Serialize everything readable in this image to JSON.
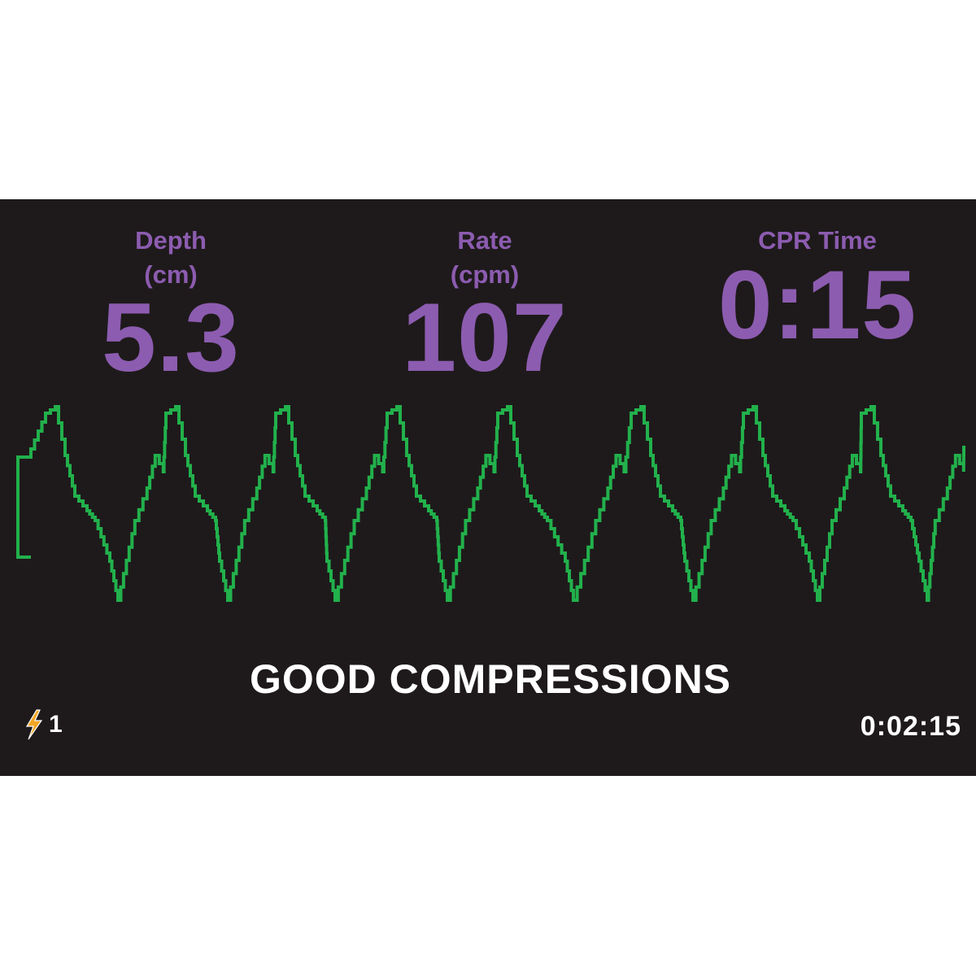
{
  "metrics": {
    "depth": {
      "label": "Depth\n(cm)",
      "value": "5.3"
    },
    "rate": {
      "label": "Rate\n(cpm)",
      "value": "107"
    },
    "cpr_time": {
      "label": "CPR Time",
      "value": "0:15"
    }
  },
  "waveform": {
    "color": "#22b14c"
  },
  "status_message": "GOOD COMPRESSIONS",
  "shock": {
    "icon": "lightning-icon",
    "count": "1",
    "icon_color": "#f5a623"
  },
  "elapsed_time": "0:02:15",
  "colors": {
    "background": "#1e1a1b",
    "metric_text": "#8c5cb0",
    "status_text": "#ffffff"
  }
}
